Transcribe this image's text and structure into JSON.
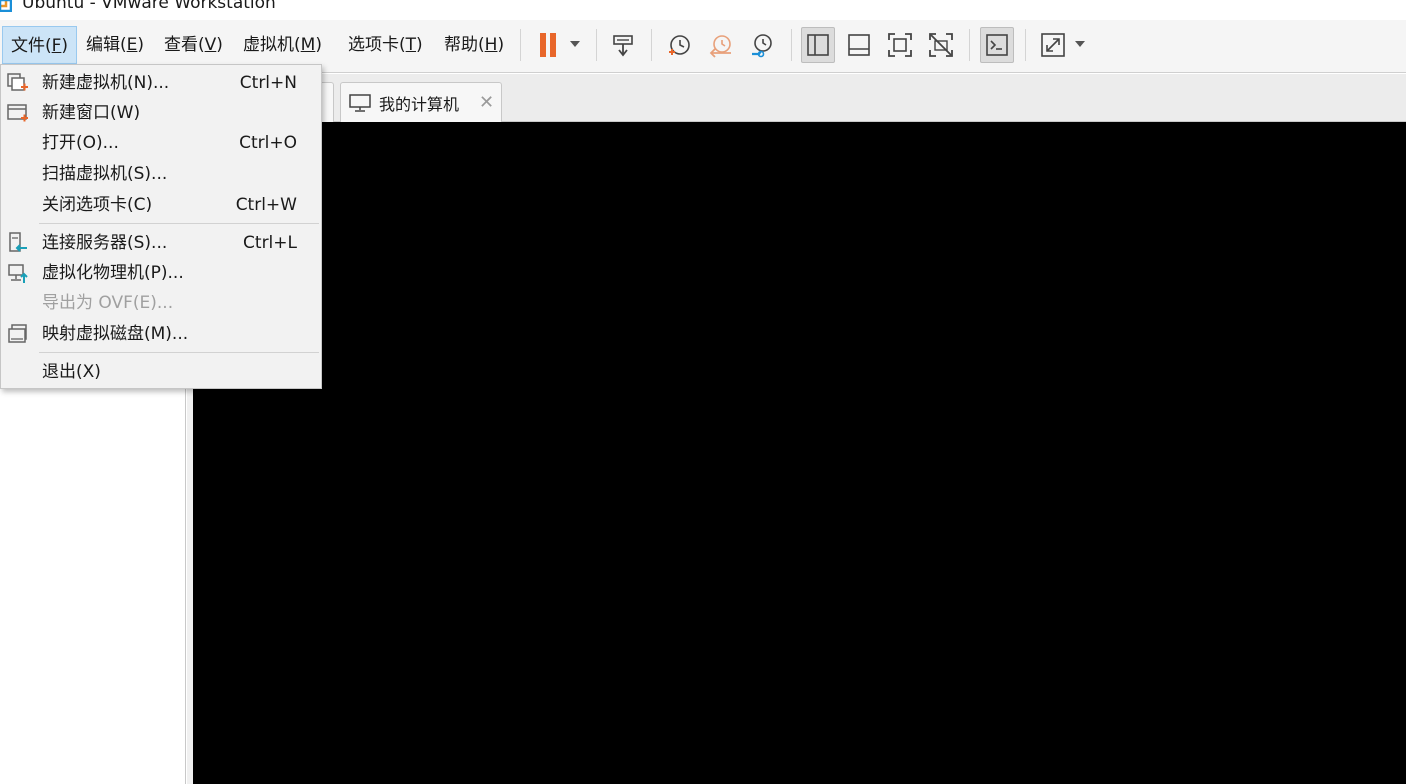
{
  "window": {
    "title": "Ubuntu - VMware Workstation"
  },
  "menubar": {
    "items": [
      {
        "label": "文件(",
        "key": "F",
        "end": ")"
      },
      {
        "label": "编辑(",
        "key": "E",
        "end": ")"
      },
      {
        "label": "查看(",
        "key": "V",
        "end": ")"
      },
      {
        "label": "虚拟机(",
        "key": "M",
        "end": ")"
      },
      {
        "label": "选项卡(",
        "key": "T",
        "end": ")"
      },
      {
        "label": "帮助(",
        "key": "H",
        "end": ")"
      }
    ]
  },
  "toolbar": {
    "icons": [
      "pause-icon",
      "send-ctrl-alt-del-icon",
      "snapshot-icon",
      "revert-snapshot-icon",
      "snapshot-manager-icon",
      "show-library-icon",
      "show-thumbnail-bar-icon",
      "full-screen-icon",
      "unity-icon",
      "console-view-icon",
      "stretch-guest-icon"
    ],
    "colors": {
      "pause": "#e8662a",
      "accent_blue": "#1a8fd8",
      "accent_orange": "#e8662a"
    }
  },
  "tabs": [
    {
      "label": "我的计算机",
      "close": "✕"
    }
  ],
  "file_menu": {
    "items": [
      {
        "label": "新建虚拟机(N)...",
        "shortcut": "Ctrl+N",
        "icon": "new-vm-icon",
        "enabled": true
      },
      {
        "label": "新建窗口(W)",
        "shortcut": "",
        "icon": "new-window-icon",
        "enabled": true
      },
      {
        "label": "打开(O)...",
        "shortcut": "Ctrl+O",
        "icon": "",
        "enabled": true
      },
      {
        "label": "扫描虚拟机(S)...",
        "shortcut": "",
        "icon": "",
        "enabled": true
      },
      {
        "label": "关闭选项卡(C)",
        "shortcut": "Ctrl+W",
        "icon": "",
        "enabled": true
      },
      {
        "label": "连接服务器(S)...",
        "shortcut": "Ctrl+L",
        "icon": "connect-server-icon",
        "enabled": true
      },
      {
        "label": "虚拟化物理机(P)...",
        "shortcut": "",
        "icon": "virtualize-physical-icon",
        "enabled": true
      },
      {
        "label": "导出为 OVF(E)...",
        "shortcut": "",
        "icon": "",
        "enabled": false
      },
      {
        "label": "映射虚拟磁盘(M)...",
        "shortcut": "",
        "icon": "map-disk-icon",
        "enabled": true
      },
      {
        "label": "退出(X)",
        "shortcut": "",
        "icon": "",
        "enabled": true
      }
    ]
  }
}
